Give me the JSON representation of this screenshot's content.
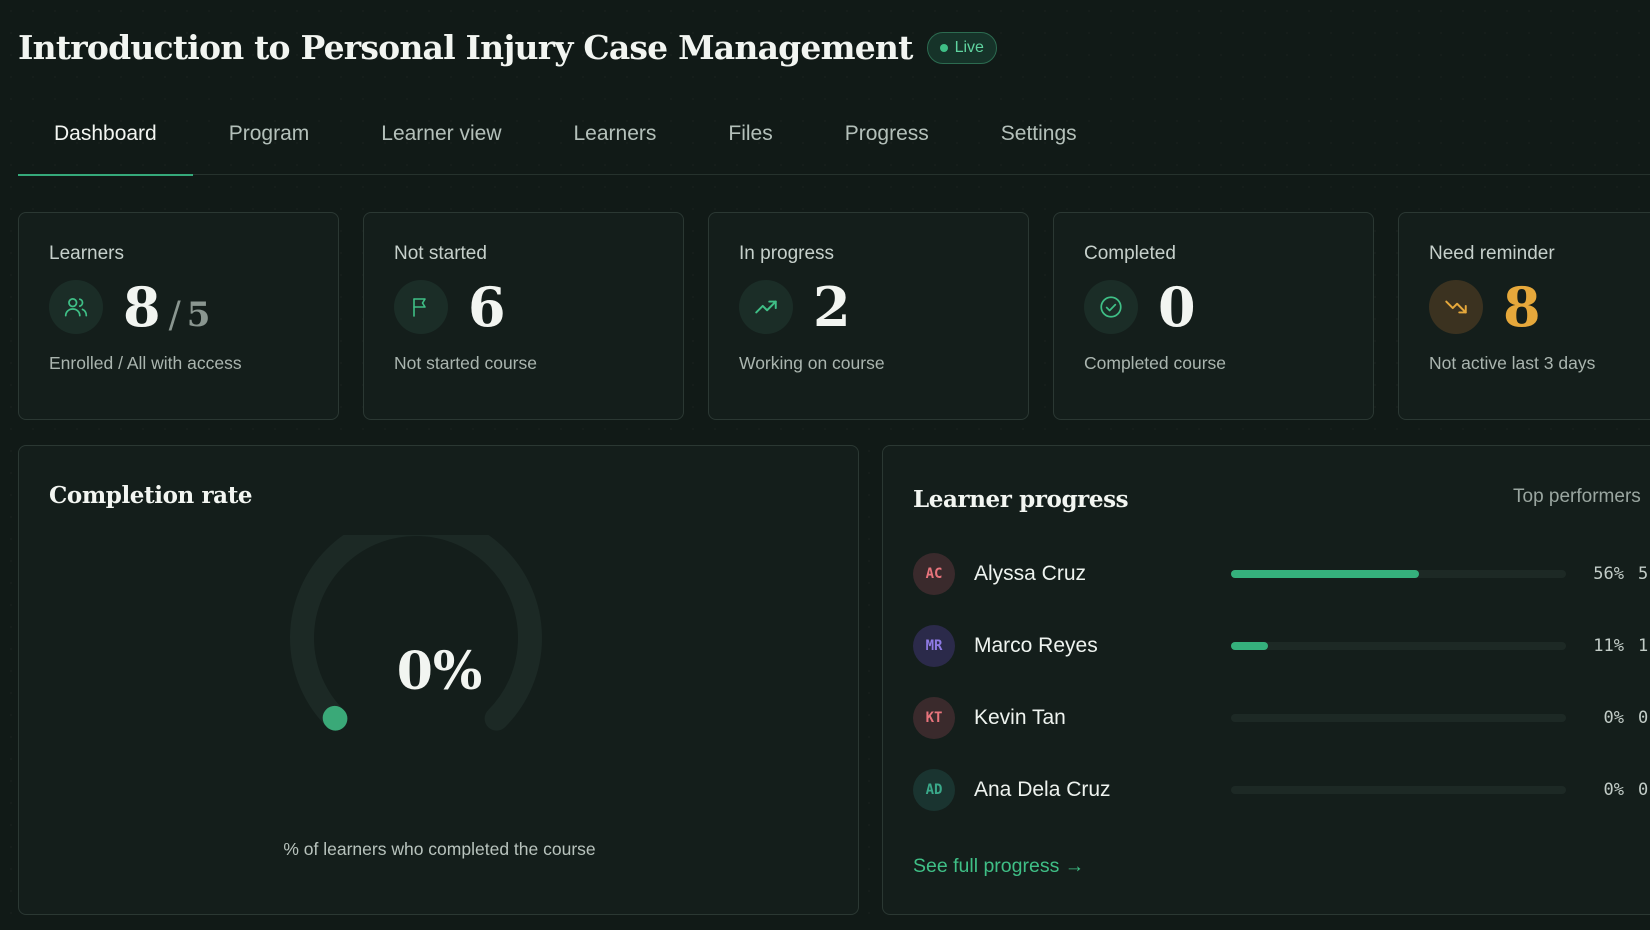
{
  "header": {
    "title": "Introduction to Personal Injury Case Management",
    "status_badge": "Live"
  },
  "tabs": [
    {
      "label": "Dashboard",
      "active": true
    },
    {
      "label": "Program",
      "active": false
    },
    {
      "label": "Learner view",
      "active": false
    },
    {
      "label": "Learners",
      "active": false
    },
    {
      "label": "Files",
      "active": false
    },
    {
      "label": "Progress",
      "active": false
    },
    {
      "label": "Settings",
      "active": false
    }
  ],
  "stats": {
    "learners": {
      "label": "Learners",
      "value": "8",
      "separator": "/",
      "total": "5",
      "sub": "Enrolled / All with access",
      "icon": "users-icon"
    },
    "not_started": {
      "label": "Not started",
      "value": "6",
      "sub": "Not started course",
      "icon": "flag-icon"
    },
    "in_progress": {
      "label": "In progress",
      "value": "2",
      "sub": "Working on course",
      "icon": "trending-up-icon"
    },
    "completed": {
      "label": "Completed",
      "value": "0",
      "sub": "Completed course",
      "icon": "check-circle-icon"
    },
    "need_reminder": {
      "label": "Need reminder",
      "value": "8",
      "sub": "Not active last 3 days",
      "icon": "trending-down-icon"
    }
  },
  "completion": {
    "title": "Completion rate",
    "value": "0%",
    "value_fraction": 0,
    "caption": "% of learners who completed the course"
  },
  "learner_progress": {
    "title": "Learner progress",
    "top_performers": "Top performers",
    "learners": [
      {
        "initials": "AC",
        "name": "Alyssa Cruz",
        "percent": 56,
        "percent_label": "56%",
        "extra": "5",
        "avatar_bg": "#3a2a2c",
        "avatar_fg": "#e8747c"
      },
      {
        "initials": "MR",
        "name": "Marco Reyes",
        "percent": 11,
        "percent_label": "11%",
        "extra": "1",
        "avatar_bg": "#2b2a4a",
        "avatar_fg": "#8f7ae6"
      },
      {
        "initials": "KT",
        "name": "Kevin Tan",
        "percent": 0,
        "percent_label": "0%",
        "extra": "0",
        "avatar_bg": "#3a2a2c",
        "avatar_fg": "#e8747c"
      },
      {
        "initials": "AD",
        "name": "Ana Dela Cruz",
        "percent": 0,
        "percent_label": "0%",
        "extra": "0",
        "avatar_bg": "#1a3430",
        "avatar_fg": "#3aa98a"
      }
    ],
    "see_full": "See full progress →"
  },
  "colors": {
    "accent": "#35b07c",
    "warning": "#e6a83b",
    "background": "#111a17"
  }
}
